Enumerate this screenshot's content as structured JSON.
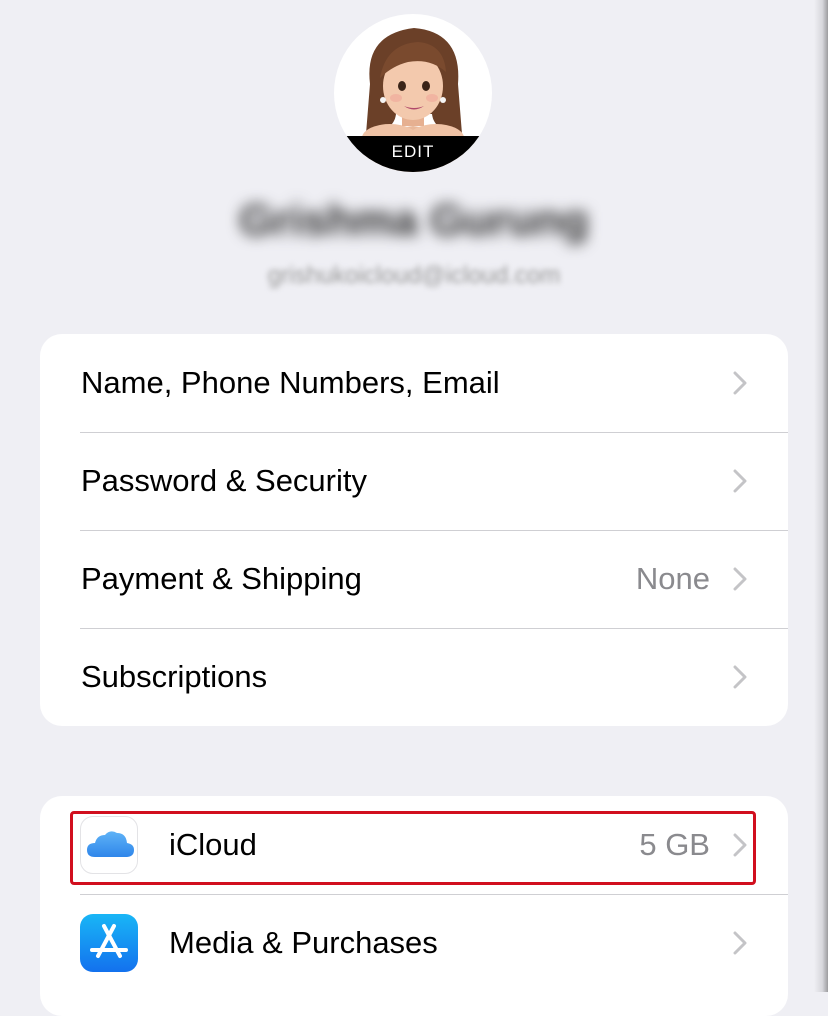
{
  "profile": {
    "edit_label": "EDIT",
    "name": "Grishma Gurung",
    "email": "grishukoicloud@icloud.com"
  },
  "account_group": {
    "rows": [
      {
        "label": "Name, Phone Numbers, Email",
        "value": ""
      },
      {
        "label": "Password & Security",
        "value": ""
      },
      {
        "label": "Payment & Shipping",
        "value": "None"
      },
      {
        "label": "Subscriptions",
        "value": ""
      }
    ]
  },
  "services_group": {
    "rows": [
      {
        "label": "iCloud",
        "value": "5 GB",
        "icon": "icloud-icon"
      },
      {
        "label": "Media & Purchases",
        "value": "",
        "icon": "app-store-icon"
      }
    ]
  },
  "colors": {
    "background": "#efeff4",
    "secondary_text": "#8a8a8e",
    "highlight": "#d10f1e",
    "icloud_blue": "#3a9af0",
    "appstore_blue": "#1a8ff2"
  }
}
